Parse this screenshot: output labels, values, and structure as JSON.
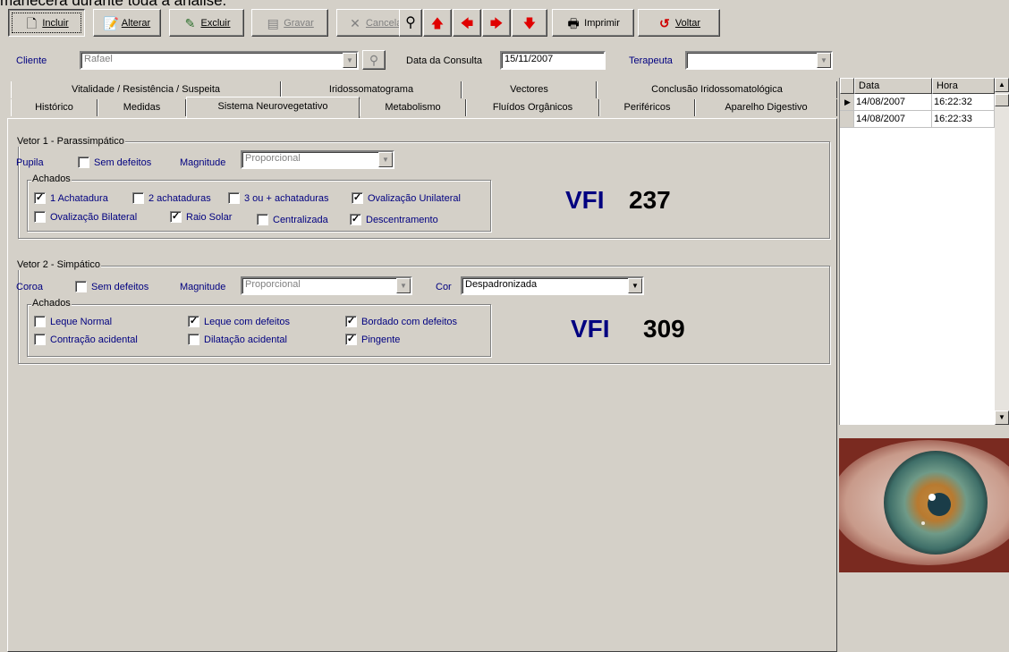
{
  "top_clipped_text": "manecera durante toda a análise.",
  "toolbar": {
    "incluir": {
      "label": "Incluir",
      "icon": "new-document-icon"
    },
    "alterar": {
      "label": "Alterar",
      "icon": "edit-icon"
    },
    "excluir": {
      "label": "Excluir",
      "icon": "delete-icon"
    },
    "gravar": {
      "label": "Gravar",
      "icon": "save-icon"
    },
    "cancelar": {
      "label": "Cancelar",
      "icon": "cancel-icon"
    },
    "imprimir": {
      "label": "Imprimir",
      "icon": "printer-icon"
    },
    "voltar": {
      "label": "Voltar",
      "icon": "back-icon"
    }
  },
  "header": {
    "cliente_label": "Cliente",
    "cliente_value": "Rafael",
    "data_label": "Data da Consulta",
    "data_value": "15/11/2007",
    "terapeuta_label": "Terapeuta",
    "terapeuta_value": ""
  },
  "tabs_row1": [
    "Vitalidade / Resistência / Suspeita",
    "Iridossomatograma",
    "Vectores",
    "Conclusão Iridossomatológica"
  ],
  "tabs_row2": [
    "Histórico",
    "Medidas",
    "Sistema Neurovegetativo",
    "Metabolismo",
    "Fluídos Orgânicos",
    "Periféricos",
    "Aparelho Digestivo"
  ],
  "active_tab": "Sistema Neurovegetativo",
  "vetor1": {
    "title": "Vetor 1 - Parassimpático",
    "pupila_label": "Pupila",
    "sem_defeitos": {
      "label": "Sem defeitos",
      "checked": false
    },
    "magnitude_label": "Magnitude",
    "magnitude_value": "Proporcional",
    "achados_title": "Achados",
    "achados": [
      {
        "label": "1 Achatadura",
        "checked": true
      },
      {
        "label": "2 achataduras",
        "checked": false
      },
      {
        "label": "3 ou + achataduras",
        "checked": false
      },
      {
        "label": "Ovalização Unilateral",
        "checked": true
      },
      {
        "label": "Ovalização Bilateral",
        "checked": false
      },
      {
        "label": "Raio Solar",
        "checked": true
      },
      {
        "label": "Centralizada",
        "checked": false
      },
      {
        "label": "Descentramento",
        "checked": true
      }
    ],
    "vfi_label": "VFI",
    "vfi_value": "237"
  },
  "vetor2": {
    "title": "Vetor 2 - Simpático",
    "coroa_label": "Coroa",
    "sem_defeitos": {
      "label": "Sem defeitos",
      "checked": false
    },
    "magnitude_label": "Magnitude",
    "magnitude_value": "Proporcional",
    "cor_label": "Cor",
    "cor_value": "Despadronizada",
    "achados_title": "Achados",
    "achados": [
      {
        "label": "Leque Normal",
        "checked": false
      },
      {
        "label": "Leque com defeitos",
        "checked": true
      },
      {
        "label": "Bordado com defeitos",
        "checked": true
      },
      {
        "label": "Contração acidental",
        "checked": false
      },
      {
        "label": "Dilatação acidental",
        "checked": false
      },
      {
        "label": "Pingente",
        "checked": true
      }
    ],
    "vfi_label": "VFI",
    "vfi_value": "309"
  },
  "grid": {
    "columns": [
      "Data",
      "Hora"
    ],
    "rows": [
      [
        "14/08/2007",
        "16:22:32"
      ],
      [
        "14/08/2007",
        "16:22:33"
      ]
    ]
  }
}
